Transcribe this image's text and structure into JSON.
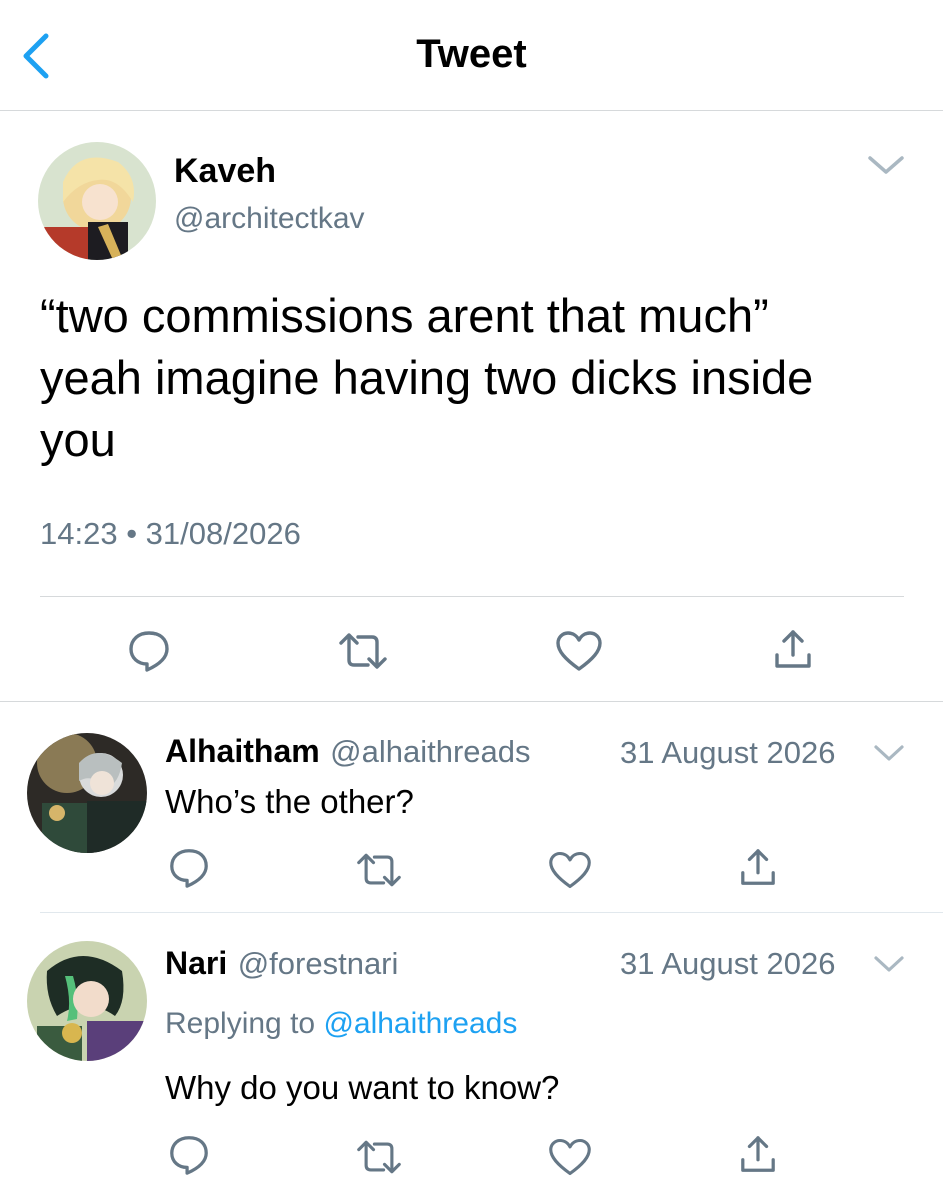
{
  "header": {
    "title": "Tweet",
    "back_icon": "chevron-left-icon"
  },
  "colors": {
    "accent": "#1da1f2",
    "muted": "#657786",
    "divider": "#d6d9db"
  },
  "main_tweet": {
    "author_name": "Kaveh",
    "author_handle": "@architectkav",
    "text_line1": "“two commissions arent that much”",
    "text_line2": "yeah imagine having two dicks inside",
    "text_line3": "you",
    "timestamp": "14:23 • 31/08/2026",
    "actions": [
      "reply-icon",
      "retweet-icon",
      "like-icon",
      "share-icon"
    ]
  },
  "replies": [
    {
      "author_name": "Alhaitham",
      "author_handle": "@alhaithreads",
      "date": "31 August 2026",
      "text": "Who’s the other?"
    },
    {
      "author_name": "Nari",
      "author_handle": "@forestnari",
      "date": "31 August 2026",
      "replying_prefix": "Replying to",
      "replying_to": "@alhaithreads",
      "text": "Why do you want to know?"
    }
  ]
}
